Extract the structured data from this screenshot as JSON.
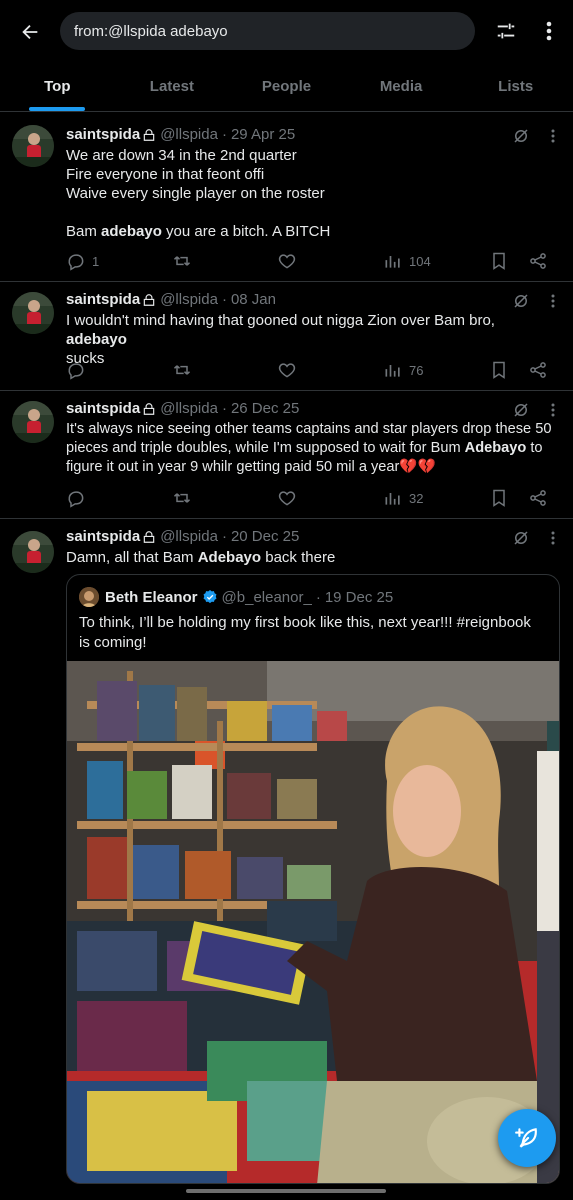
{
  "search": {
    "query": "from:@llspida adebayo"
  },
  "tabs": [
    "Top",
    "Latest",
    "People",
    "Media",
    "Lists"
  ],
  "tweets": [
    {
      "name": "saintspida",
      "handle": "@llspida",
      "time": "29 Apr 25",
      "lines": [
        "We are down 34 in the 2nd quarter",
        "Fire everyone in that feont offi",
        "Waive every single player on the roster",
        "",
        {
          "pre": "Bam ",
          "bold": "adebayo",
          "post": " you are a bitch. A BITCH"
        }
      ],
      "replies": "1",
      "reposts": "",
      "likes": "",
      "views": "104"
    },
    {
      "name": "saintspida",
      "handle": "@llspida",
      "time": "08 Jan",
      "lines": [
        {
          "pre": "I wouldn't mind having that gooned out nigga Zion over Bam bro, ",
          "bold": "adebayo",
          "post": ""
        },
        "sucks"
      ],
      "replies": "",
      "reposts": "",
      "likes": "",
      "views": "76"
    },
    {
      "name": "saintspida",
      "handle": "@llspida",
      "time": "26 Dec 25",
      "lines": [
        "It's always nice seeing other teams captains and star players drop these 50",
        {
          "pre": "pieces and triple doubles, while I'm supposed to wait for Bum ",
          "bold": "Adebayo",
          "post": " to"
        },
        "figure it out in year 9 whilr getting paid 50 mil a year💔💔"
      ],
      "replies": "",
      "reposts": "",
      "likes": "",
      "views": "32"
    },
    {
      "name": "saintspida",
      "handle": "@llspida",
      "time": "20 Dec 25",
      "lines": [
        {
          "pre": "Damn, all that Bam ",
          "bold": "Adebayo",
          "post": " back there"
        }
      ]
    }
  ],
  "quote": {
    "name": "Beth Eleanor",
    "handle": "@b_eleanor_",
    "time": "19 Dec 25",
    "text": "To think, I’ll be holding my first book like this, next year!!! #reignbook is coming!"
  },
  "colors": {
    "accent": "#1d9bf0",
    "muted": "#71767b",
    "text": "#e7e9ea",
    "border": "#2f3336"
  },
  "icons": [
    "back-arrow-icon",
    "filter-icon",
    "more-vertical-icon",
    "lock-icon",
    "grok-icon",
    "reply-icon",
    "repost-icon",
    "like-icon",
    "views-icon",
    "bookmark-icon",
    "share-icon",
    "verified-icon",
    "compose-icon"
  ]
}
